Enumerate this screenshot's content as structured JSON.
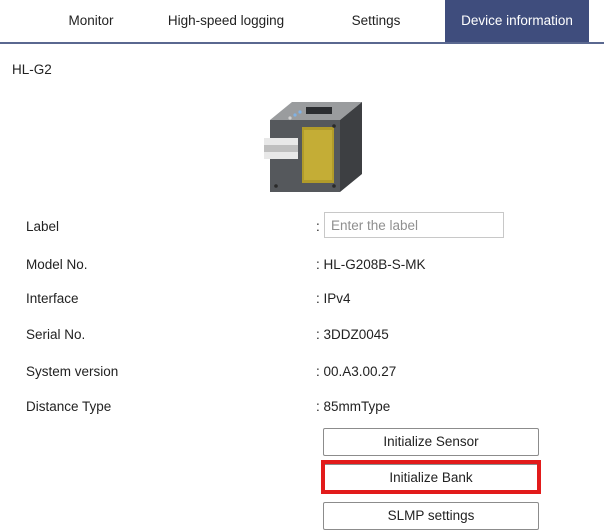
{
  "tabs": [
    {
      "label": "Monitor"
    },
    {
      "label": "High-speed logging"
    },
    {
      "label": "Settings"
    },
    {
      "label": "Device information",
      "active": true
    }
  ],
  "device": {
    "name": "HL-G2",
    "image": "laser-sensor-illustration"
  },
  "info_rows": {
    "label": {
      "label": "Label",
      "separator": ":",
      "placeholder": "Enter the label",
      "value": ""
    },
    "model": {
      "label": "Model No.",
      "value": ": HL-G208B-S-MK"
    },
    "interface": {
      "label": "Interface",
      "value": ": IPv4"
    },
    "serial": {
      "label": "Serial No.",
      "value": ": 3DDZ0045"
    },
    "system_version": {
      "label": "System version",
      "value": ": 00.A3.00.27"
    },
    "distance_type": {
      "label": "Distance Type",
      "value": ": 85mmType"
    }
  },
  "buttons": {
    "initialize_sensor": "Initialize Sensor",
    "initialize_bank": "Initialize Bank",
    "slmp_settings": "SLMP settings"
  },
  "colors": {
    "active_tab": "#3f4d7d",
    "highlight": "#e21b1b"
  }
}
